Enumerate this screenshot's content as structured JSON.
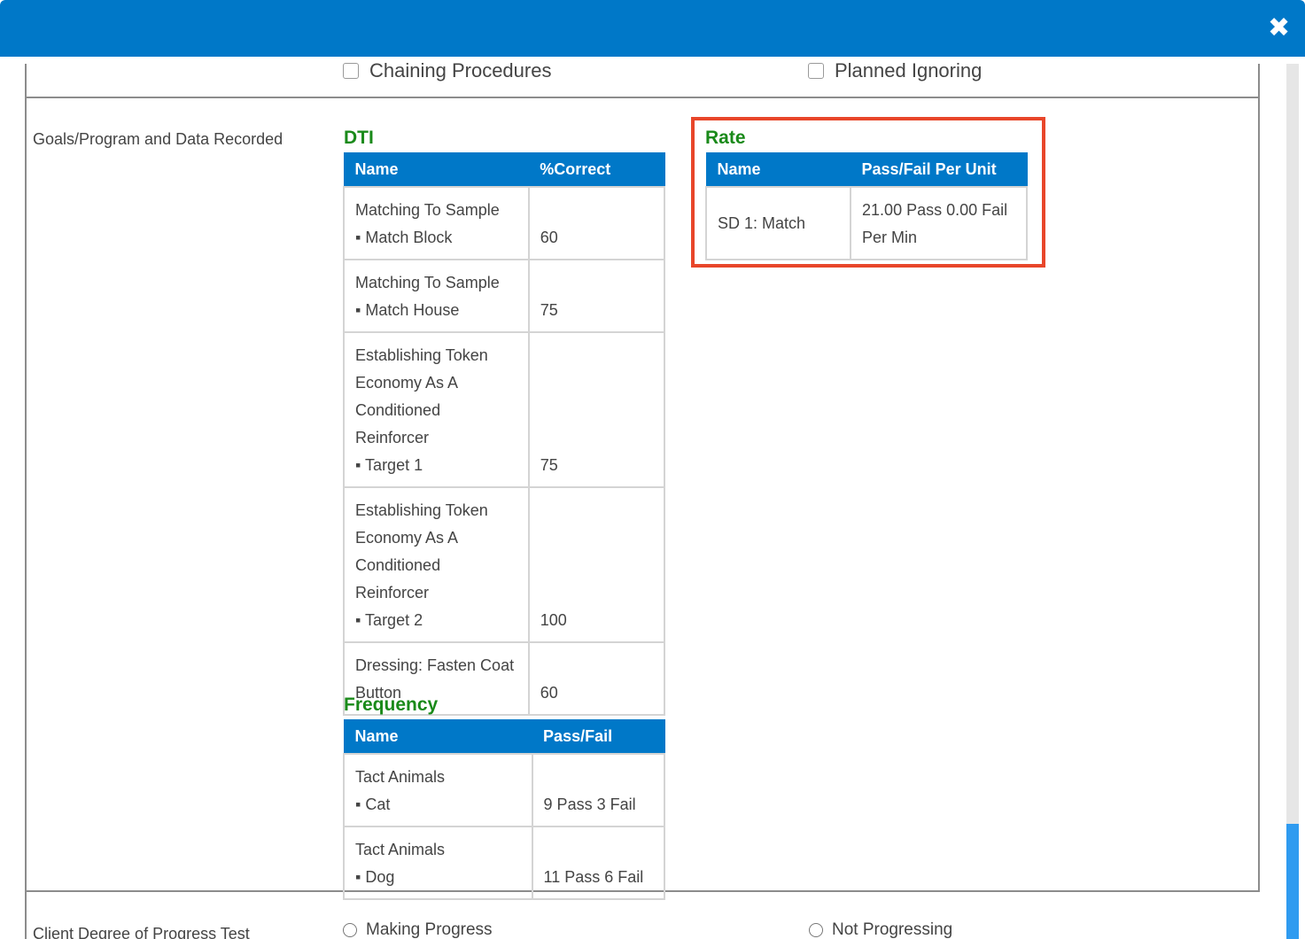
{
  "dialog": {
    "close_icon": "close-icon"
  },
  "top_options": {
    "left": "Chaining Procedures",
    "right": "Planned Ignoring"
  },
  "goals_label": "Goals/Program and Data Recorded",
  "dti": {
    "title": "DTI",
    "headers": [
      "Name",
      "%Correct"
    ],
    "rows": [
      {
        "name": "Matching To Sample",
        "sub": "▪ Match Block",
        "value": "60"
      },
      {
        "name": "Matching To Sample",
        "sub": "▪ Match House",
        "value": "75"
      },
      {
        "name": "Establishing Token Economy As A Conditioned Reinforcer",
        "sub": "▪ Target 1",
        "value": "75"
      },
      {
        "name": "Establishing Token Economy As A Conditioned Reinforcer",
        "sub": "▪ Target 2",
        "value": "100"
      },
      {
        "name": "Dressing: Fasten Coat Button",
        "sub": "",
        "value": "60"
      }
    ]
  },
  "rate": {
    "title": "Rate",
    "headers": [
      "Name",
      "Pass/Fail Per Unit"
    ],
    "rows": [
      {
        "name": "SD 1: Match",
        "value": "21.00 Pass 0.00 Fail Per Min"
      }
    ]
  },
  "frequency": {
    "title": "Frequency",
    "headers": [
      "Name",
      "Pass/Fail"
    ],
    "rows": [
      {
        "name": "Tact Animals",
        "sub": "▪ Cat",
        "value": "9 Pass 3 Fail"
      },
      {
        "name": "Tact Animals",
        "sub": "▪ Dog",
        "value": "11 Pass 6 Fail"
      }
    ]
  },
  "progress": {
    "label": "Client Degree of Progress Test",
    "option_left": "Making Progress",
    "option_right": "Not Progressing"
  }
}
